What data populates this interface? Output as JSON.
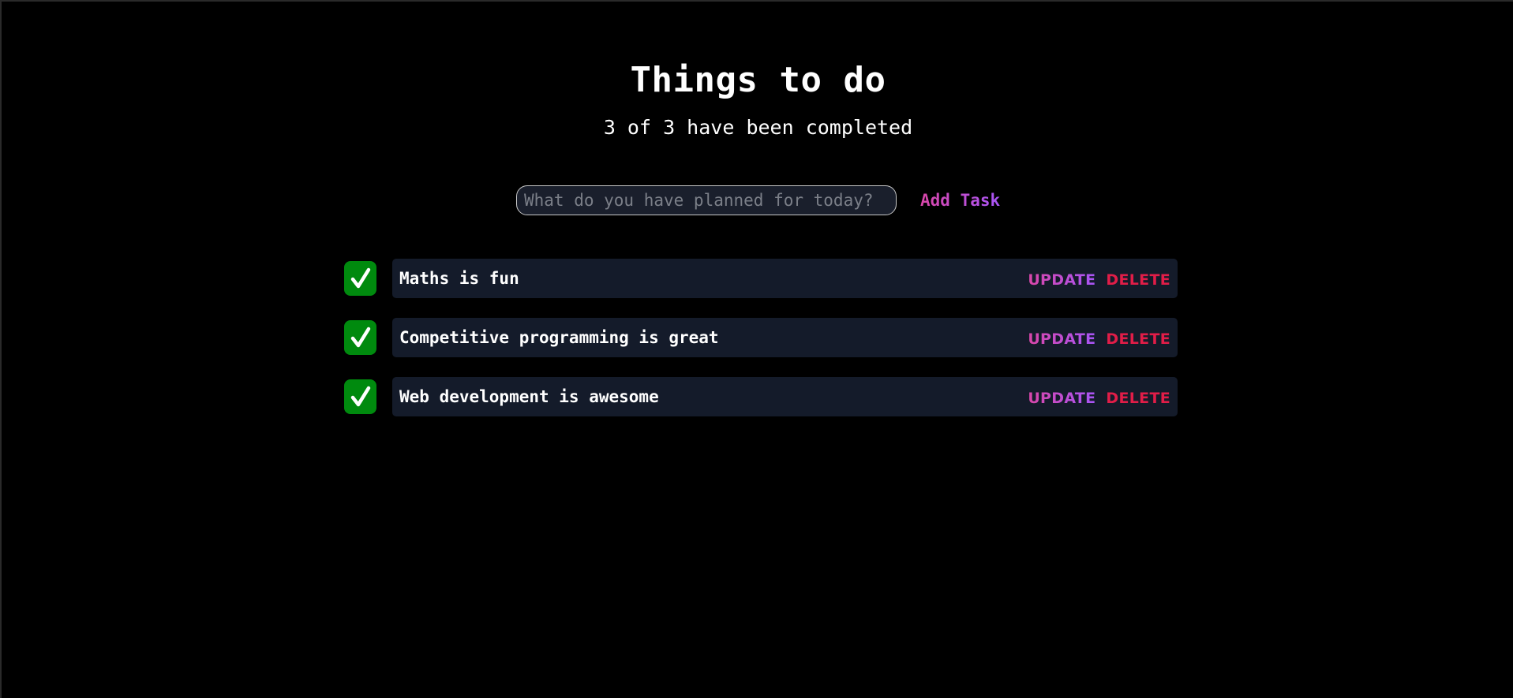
{
  "header": {
    "title": "Things to do",
    "summary": "3 of 3 have been completed"
  },
  "add_task": {
    "placeholder": "What do you have planned for today?",
    "value": "",
    "button_label": "Add Task"
  },
  "tasks": [
    {
      "text": "Maths is fun",
      "completed": true,
      "check_icon": "checkmark-icon",
      "update_label": "UPDATE",
      "delete_label": "DELETE"
    },
    {
      "text": "Competitive programming is great",
      "completed": true,
      "check_icon": "checkmark-icon",
      "update_label": "UPDATE",
      "delete_label": "DELETE"
    },
    {
      "text": "Web development is awesome",
      "completed": true,
      "check_icon": "checkmark-icon",
      "update_label": "UPDATE",
      "delete_label": "DELETE"
    }
  ],
  "colors": {
    "background": "#000000",
    "check_green": "#008a0e",
    "card": "#141b2a",
    "accent_gradient_start": "#d946a8",
    "accent_gradient_end": "#a855f7",
    "delete_red": "#e11d48"
  }
}
